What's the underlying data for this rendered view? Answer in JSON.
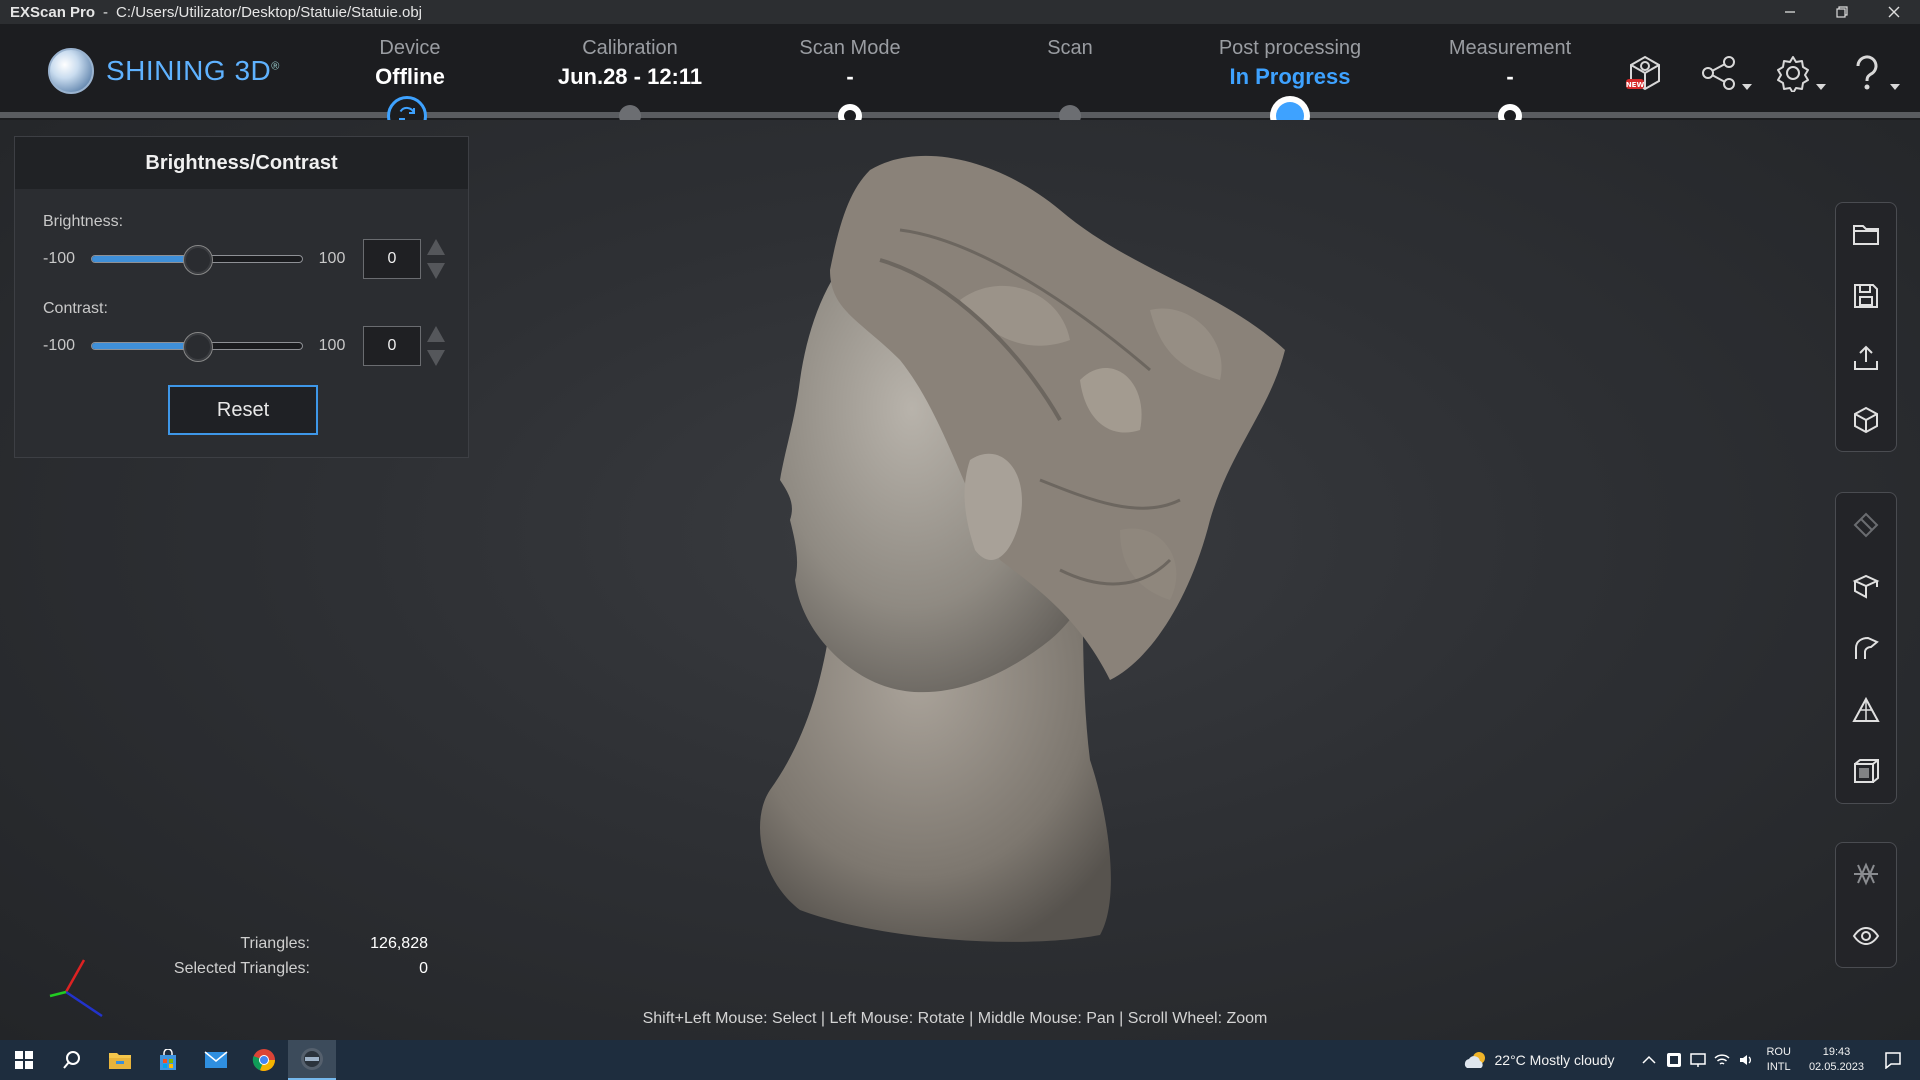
{
  "titlebar": {
    "app_name": "EXScan Pro",
    "separator": "-",
    "file_path": "C:/Users/Utilizator/Desktop/Statuie/Statuie.obj"
  },
  "brand": {
    "name": "SHINING 3D",
    "mark": "®"
  },
  "steps": [
    {
      "label": "Device",
      "value": "Offline"
    },
    {
      "label": "Calibration",
      "value": "Jun.28 - 12:11"
    },
    {
      "label": "Scan Mode",
      "value": "-"
    },
    {
      "label": "Scan",
      "value": ""
    },
    {
      "label": "Post processing",
      "value": "In Progress"
    },
    {
      "label": "Measurement",
      "value": "-"
    }
  ],
  "header_icons": [
    "new-scanner-icon",
    "share-icon",
    "settings-icon",
    "help-icon"
  ],
  "new_badge": "NEW",
  "panel": {
    "title": "Brightness/Contrast",
    "brightness": {
      "label": "Brightness:",
      "min": "-100",
      "max": "100",
      "value": "0",
      "fraction": 0.5
    },
    "contrast": {
      "label": "Contrast:",
      "min": "-100",
      "max": "100",
      "value": "0",
      "fraction": 0.5
    },
    "reset_label": "Reset"
  },
  "right_toolbar": {
    "group1": [
      "open-folder-icon",
      "save-icon",
      "export-icon",
      "model-cube-icon"
    ],
    "group2": [
      "eraser-icon",
      "plane-cut-icon",
      "curve-icon",
      "triangle-mesh-icon",
      "box-select-icon"
    ],
    "group3": [
      "wireframe-icon",
      "visibility-icon"
    ]
  },
  "stats": {
    "triangles_label": "Triangles:",
    "triangles_value": "126,828",
    "selected_label": "Selected Triangles:",
    "selected_value": "0"
  },
  "hint": "Shift+Left Mouse: Select | Left Mouse: Rotate | Middle Mouse: Pan | Scroll Wheel: Zoom",
  "taskbar": {
    "weather": "22°C  Mostly cloudy",
    "lang_top": "ROU",
    "lang_bottom": "INTL",
    "time": "19:43",
    "date": "02.05.2023"
  },
  "colors": {
    "accent": "#3ea2ff",
    "header_bg": "#1c1d20",
    "viewport_bg": "#2e3034",
    "taskbar_bg": "#1e2d3e"
  }
}
